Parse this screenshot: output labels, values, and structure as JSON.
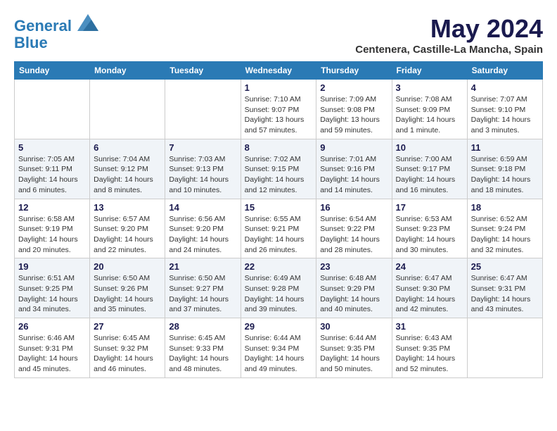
{
  "logo": {
    "line1": "General",
    "line2": "Blue"
  },
  "title": "May 2024",
  "location": "Centenera, Castille-La Mancha, Spain",
  "days_of_week": [
    "Sunday",
    "Monday",
    "Tuesday",
    "Wednesday",
    "Thursday",
    "Friday",
    "Saturday"
  ],
  "weeks": [
    [
      {
        "day": "",
        "info": ""
      },
      {
        "day": "",
        "info": ""
      },
      {
        "day": "",
        "info": ""
      },
      {
        "day": "1",
        "info": "Sunrise: 7:10 AM\nSunset: 9:07 PM\nDaylight: 13 hours and 57 minutes."
      },
      {
        "day": "2",
        "info": "Sunrise: 7:09 AM\nSunset: 9:08 PM\nDaylight: 13 hours and 59 minutes."
      },
      {
        "day": "3",
        "info": "Sunrise: 7:08 AM\nSunset: 9:09 PM\nDaylight: 14 hours and 1 minute."
      },
      {
        "day": "4",
        "info": "Sunrise: 7:07 AM\nSunset: 9:10 PM\nDaylight: 14 hours and 3 minutes."
      }
    ],
    [
      {
        "day": "5",
        "info": "Sunrise: 7:05 AM\nSunset: 9:11 PM\nDaylight: 14 hours and 6 minutes."
      },
      {
        "day": "6",
        "info": "Sunrise: 7:04 AM\nSunset: 9:12 PM\nDaylight: 14 hours and 8 minutes."
      },
      {
        "day": "7",
        "info": "Sunrise: 7:03 AM\nSunset: 9:13 PM\nDaylight: 14 hours and 10 minutes."
      },
      {
        "day": "8",
        "info": "Sunrise: 7:02 AM\nSunset: 9:15 PM\nDaylight: 14 hours and 12 minutes."
      },
      {
        "day": "9",
        "info": "Sunrise: 7:01 AM\nSunset: 9:16 PM\nDaylight: 14 hours and 14 minutes."
      },
      {
        "day": "10",
        "info": "Sunrise: 7:00 AM\nSunset: 9:17 PM\nDaylight: 14 hours and 16 minutes."
      },
      {
        "day": "11",
        "info": "Sunrise: 6:59 AM\nSunset: 9:18 PM\nDaylight: 14 hours and 18 minutes."
      }
    ],
    [
      {
        "day": "12",
        "info": "Sunrise: 6:58 AM\nSunset: 9:19 PM\nDaylight: 14 hours and 20 minutes."
      },
      {
        "day": "13",
        "info": "Sunrise: 6:57 AM\nSunset: 9:20 PM\nDaylight: 14 hours and 22 minutes."
      },
      {
        "day": "14",
        "info": "Sunrise: 6:56 AM\nSunset: 9:20 PM\nDaylight: 14 hours and 24 minutes."
      },
      {
        "day": "15",
        "info": "Sunrise: 6:55 AM\nSunset: 9:21 PM\nDaylight: 14 hours and 26 minutes."
      },
      {
        "day": "16",
        "info": "Sunrise: 6:54 AM\nSunset: 9:22 PM\nDaylight: 14 hours and 28 minutes."
      },
      {
        "day": "17",
        "info": "Sunrise: 6:53 AM\nSunset: 9:23 PM\nDaylight: 14 hours and 30 minutes."
      },
      {
        "day": "18",
        "info": "Sunrise: 6:52 AM\nSunset: 9:24 PM\nDaylight: 14 hours and 32 minutes."
      }
    ],
    [
      {
        "day": "19",
        "info": "Sunrise: 6:51 AM\nSunset: 9:25 PM\nDaylight: 14 hours and 34 minutes."
      },
      {
        "day": "20",
        "info": "Sunrise: 6:50 AM\nSunset: 9:26 PM\nDaylight: 14 hours and 35 minutes."
      },
      {
        "day": "21",
        "info": "Sunrise: 6:50 AM\nSunset: 9:27 PM\nDaylight: 14 hours and 37 minutes."
      },
      {
        "day": "22",
        "info": "Sunrise: 6:49 AM\nSunset: 9:28 PM\nDaylight: 14 hours and 39 minutes."
      },
      {
        "day": "23",
        "info": "Sunrise: 6:48 AM\nSunset: 9:29 PM\nDaylight: 14 hours and 40 minutes."
      },
      {
        "day": "24",
        "info": "Sunrise: 6:47 AM\nSunset: 9:30 PM\nDaylight: 14 hours and 42 minutes."
      },
      {
        "day": "25",
        "info": "Sunrise: 6:47 AM\nSunset: 9:31 PM\nDaylight: 14 hours and 43 minutes."
      }
    ],
    [
      {
        "day": "26",
        "info": "Sunrise: 6:46 AM\nSunset: 9:31 PM\nDaylight: 14 hours and 45 minutes."
      },
      {
        "day": "27",
        "info": "Sunrise: 6:45 AM\nSunset: 9:32 PM\nDaylight: 14 hours and 46 minutes."
      },
      {
        "day": "28",
        "info": "Sunrise: 6:45 AM\nSunset: 9:33 PM\nDaylight: 14 hours and 48 minutes."
      },
      {
        "day": "29",
        "info": "Sunrise: 6:44 AM\nSunset: 9:34 PM\nDaylight: 14 hours and 49 minutes."
      },
      {
        "day": "30",
        "info": "Sunrise: 6:44 AM\nSunset: 9:35 PM\nDaylight: 14 hours and 50 minutes."
      },
      {
        "day": "31",
        "info": "Sunrise: 6:43 AM\nSunset: 9:35 PM\nDaylight: 14 hours and 52 minutes."
      },
      {
        "day": "",
        "info": ""
      }
    ]
  ]
}
